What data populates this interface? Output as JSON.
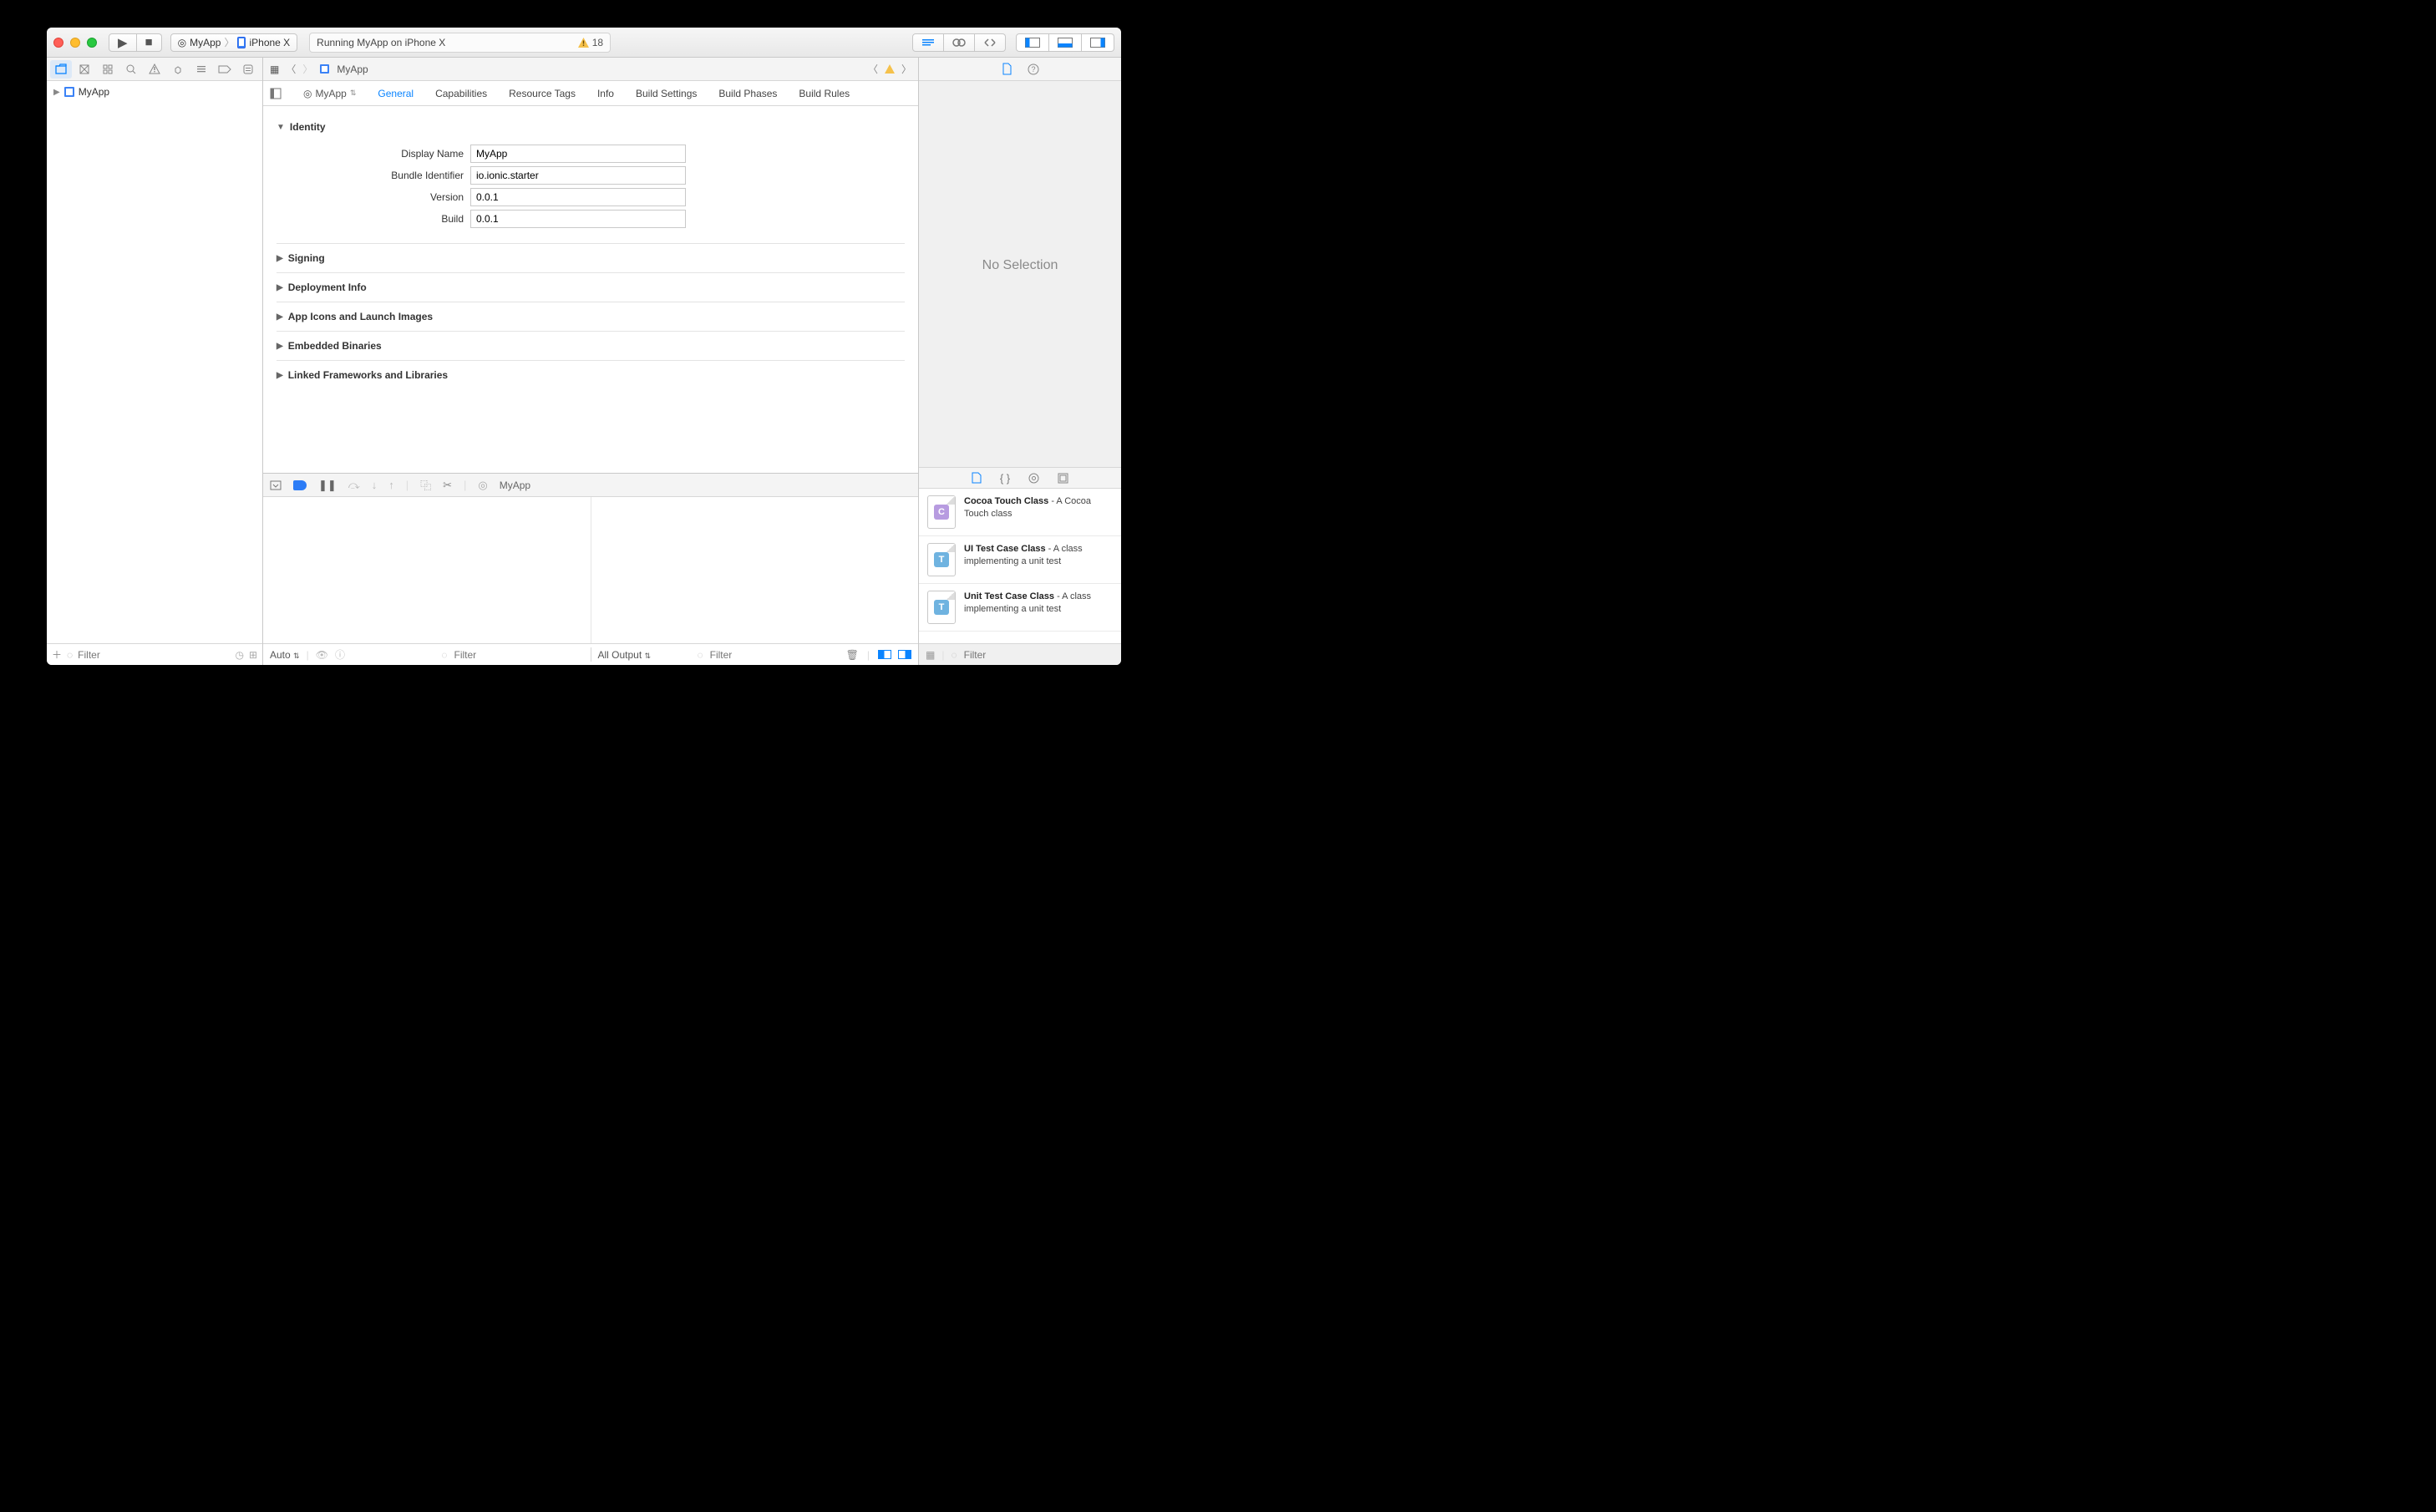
{
  "titlebar": {
    "scheme_app": "MyApp",
    "scheme_device": "iPhone X",
    "activity_text": "Running MyApp on iPhone X",
    "warning_count": "18"
  },
  "navigator": {
    "project_name": "MyApp",
    "filter_placeholder": "Filter"
  },
  "jumpbar": {
    "crumb": "MyApp"
  },
  "target_selector": "MyApp",
  "editor_tabs": [
    "General",
    "Capabilities",
    "Resource Tags",
    "Info",
    "Build Settings",
    "Build Phases",
    "Build Rules"
  ],
  "editor_active_tab": "General",
  "sections": {
    "identity": {
      "title": "Identity",
      "expanded": true,
      "fields": {
        "display_name_label": "Display Name",
        "display_name_value": "MyApp",
        "bundle_id_label": "Bundle Identifier",
        "bundle_id_value": "io.ionic.starter",
        "version_label": "Version",
        "version_value": "0.0.1",
        "build_label": "Build",
        "build_value": "0.0.1"
      }
    },
    "signing": {
      "title": "Signing"
    },
    "deployment": {
      "title": "Deployment Info"
    },
    "icons": {
      "title": "App Icons and Launch Images"
    },
    "embedded": {
      "title": "Embedded Binaries"
    },
    "linked": {
      "title": "Linked Frameworks and Libraries"
    }
  },
  "debug": {
    "process": "MyApp",
    "auto_label": "Auto",
    "var_filter_placeholder": "Filter",
    "output_label": "All Output",
    "console_filter_placeholder": "Filter"
  },
  "inspector": {
    "no_selection": "No Selection"
  },
  "library": {
    "items": [
      {
        "title": "Cocoa Touch Class",
        "desc": "A Cocoa Touch class",
        "glyph": "C",
        "color": "#b79be0"
      },
      {
        "title": "UI Test Case Class",
        "desc": "A class implementing a unit test",
        "glyph": "T",
        "color": "#6fb3e0"
      },
      {
        "title": "Unit Test Case Class",
        "desc": "A class implementing a unit test",
        "glyph": "T",
        "color": "#6fb3e0"
      }
    ],
    "filter_placeholder": "Filter"
  }
}
